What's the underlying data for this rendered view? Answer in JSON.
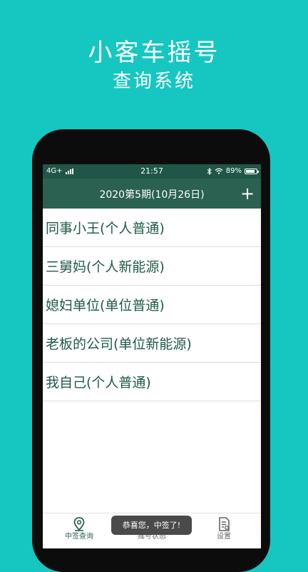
{
  "promo": {
    "title": "小客车摇号",
    "subtitle": "查询系统"
  },
  "status_bar": {
    "carrier": "4G+",
    "time": "21:57",
    "battery": "89%",
    "battery_level": 0.89
  },
  "nav": {
    "title": "2020第5期(10月26日)",
    "add_label": "+"
  },
  "list_items": [
    {
      "label": "同事小王(个人普通)"
    },
    {
      "label": "三舅妈(个人新能源)"
    },
    {
      "label": "媳妇单位(单位普通)"
    },
    {
      "label": "老板的公司(单位新能源)"
    },
    {
      "label": "我自己(个人普通)"
    }
  ],
  "tabs": [
    {
      "label": "中签查询",
      "icon": "location-pin-icon",
      "active": true
    },
    {
      "label": "摇号状态",
      "icon": "status-icon",
      "active": false
    },
    {
      "label": "设置",
      "icon": "settings-document-icon",
      "active": false
    }
  ],
  "toast": {
    "message": "恭喜您，中签了!"
  },
  "colors": {
    "background": "#16c7c1",
    "status_bar": "#1f5647",
    "nav_bar": "#2a6150",
    "list_text": "#1f5a4a"
  }
}
